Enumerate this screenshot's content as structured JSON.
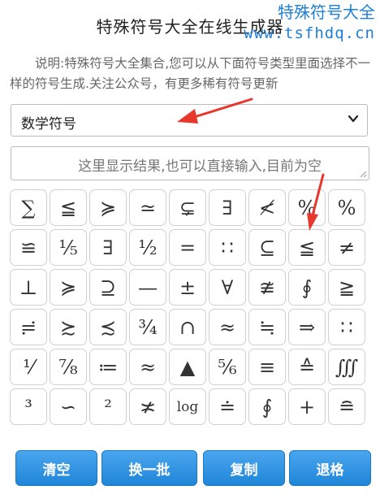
{
  "header": {
    "title": "特殊符号大全在线生成器",
    "watermark_line1": "特殊符号大全",
    "watermark_line2": "www.tsfhdq.cn"
  },
  "description": "说明:特殊符号大全集合,您可以从下面符号类型里面选择不一样的符号生成.关注公众号，有更多稀有符号更新",
  "category_select": {
    "value": "数学符号"
  },
  "result_box": {
    "placeholder": "这里显示结果,也可以直接输入,目前为空"
  },
  "symbols": [
    "∑",
    "≦",
    "≽",
    "≃",
    "⊊",
    "∃",
    "≮",
    "%",
    "%",
    "≌",
    "⅕",
    "∃",
    "½",
    "=",
    "∷",
    "⊆",
    "≦",
    "≠",
    "⊥",
    "≽",
    "⊇",
    "—",
    "±",
    "∀",
    "≇",
    "∮",
    "≧",
    "≓",
    "≿",
    "≾",
    "¾",
    "∩",
    "≈",
    "≒",
    "⇒",
    "∷",
    "⅟",
    "⅞",
    "≔",
    "≈",
    "▲",
    "⅚",
    "≡",
    "≙",
    "∭",
    "³",
    "∽",
    "²",
    "≭",
    "log",
    "≐",
    "∮",
    "+",
    "≘"
  ],
  "actions": {
    "clear": "清空",
    "refresh": "换一批",
    "copy": "复制",
    "backspace": "退格"
  },
  "colors": {
    "accent": "#1e7fd8",
    "arrow": "#e8372c"
  }
}
